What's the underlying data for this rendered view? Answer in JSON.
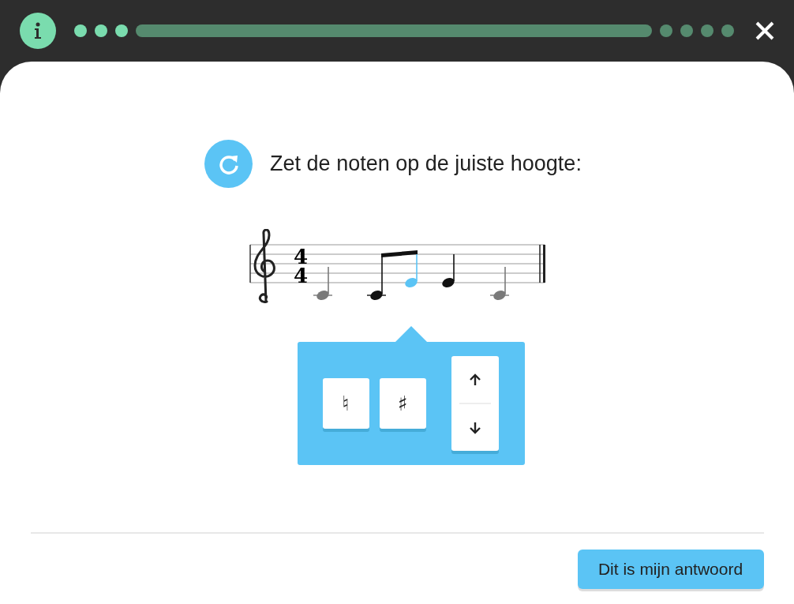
{
  "progress": {
    "steps": [
      {
        "kind": "done"
      },
      {
        "kind": "done"
      },
      {
        "kind": "done"
      },
      {
        "kind": "current"
      },
      {
        "kind": "todo"
      },
      {
        "kind": "todo"
      },
      {
        "kind": "todo"
      },
      {
        "kind": "todo"
      }
    ]
  },
  "question": {
    "text": "Zet de noten op de juiste hoogte:"
  },
  "staff": {
    "time_signature": [
      "4",
      "4"
    ],
    "notes": [
      {
        "kind": "given",
        "selected": false
      },
      {
        "kind": "placed",
        "selected": false
      },
      {
        "kind": "placed",
        "selected": true
      },
      {
        "kind": "placed",
        "selected": false
      },
      {
        "kind": "given",
        "selected": false
      }
    ]
  },
  "editor": {
    "accidentals": [
      "♮",
      "♯"
    ]
  },
  "submit": {
    "label": "Dit is mijn antwoord"
  }
}
